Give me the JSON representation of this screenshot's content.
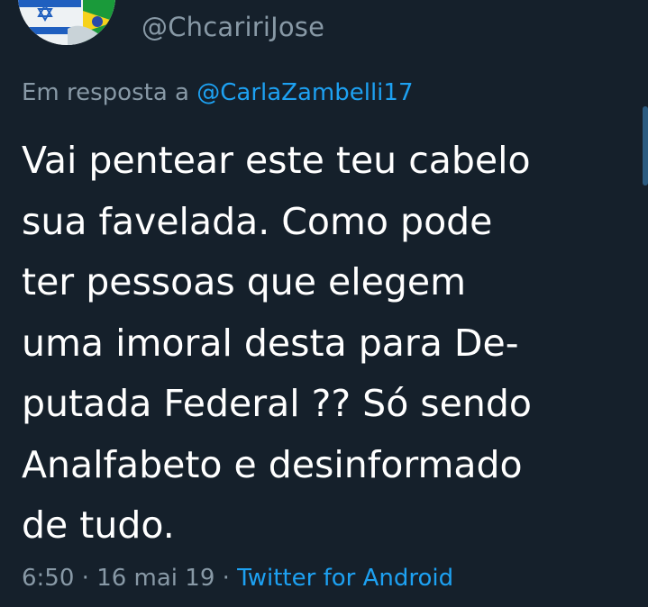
{
  "user": {
    "handle": "@ChcaririJose",
    "avatar_icon": "flag-avatar-icon"
  },
  "reply": {
    "prefix": "Em resposta a ",
    "mention": "@CarlaZambelli17"
  },
  "tweet": {
    "lines": [
      "Vai pentear este teu cabelo",
      "sua favelada. Como pode",
      "ter pessoas que elegem",
      "uma imoral desta para De-",
      "putada Federal ?? Só sendo",
      "Analfabeto e desinformado",
      "de tudo."
    ]
  },
  "meta": {
    "time": "6:50",
    "separator": " · ",
    "date": "16 mai 19",
    "source": "Twitter for Android"
  },
  "colors": {
    "background": "#15202b",
    "secondary_text": "#8899a6",
    "link": "#1da1f2",
    "primary_text": "#ffffff"
  }
}
